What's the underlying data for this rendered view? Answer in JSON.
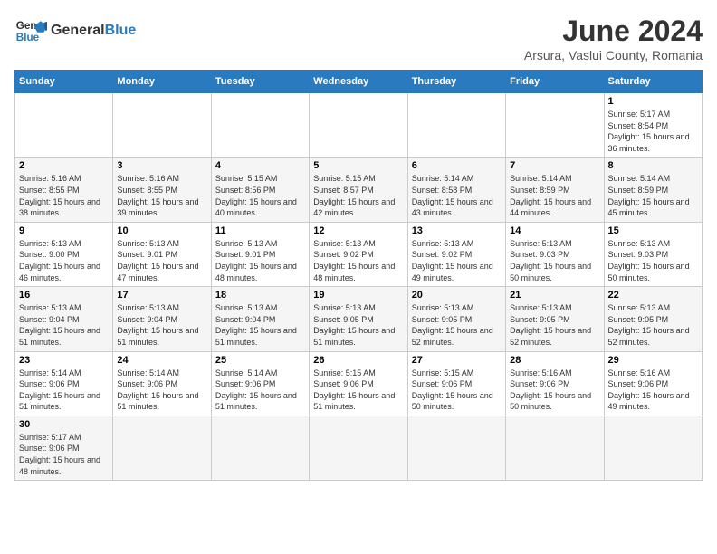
{
  "header": {
    "logo_general": "General",
    "logo_blue": "Blue",
    "month_title": "June 2024",
    "subtitle": "Arsura, Vaslui County, Romania"
  },
  "weekdays": [
    "Sunday",
    "Monday",
    "Tuesday",
    "Wednesday",
    "Thursday",
    "Friday",
    "Saturday"
  ],
  "weeks": [
    [
      {
        "day": "",
        "info": ""
      },
      {
        "day": "",
        "info": ""
      },
      {
        "day": "",
        "info": ""
      },
      {
        "day": "",
        "info": ""
      },
      {
        "day": "",
        "info": ""
      },
      {
        "day": "",
        "info": ""
      },
      {
        "day": "1",
        "info": "Sunrise: 5:17 AM\nSunset: 8:54 PM\nDaylight: 15 hours and 36 minutes."
      }
    ],
    [
      {
        "day": "2",
        "info": "Sunrise: 5:16 AM\nSunset: 8:55 PM\nDaylight: 15 hours and 38 minutes."
      },
      {
        "day": "3",
        "info": "Sunrise: 5:16 AM\nSunset: 8:55 PM\nDaylight: 15 hours and 39 minutes."
      },
      {
        "day": "4",
        "info": "Sunrise: 5:15 AM\nSunset: 8:56 PM\nDaylight: 15 hours and 40 minutes."
      },
      {
        "day": "5",
        "info": "Sunrise: 5:15 AM\nSunset: 8:57 PM\nDaylight: 15 hours and 42 minutes."
      },
      {
        "day": "6",
        "info": "Sunrise: 5:14 AM\nSunset: 8:58 PM\nDaylight: 15 hours and 43 minutes."
      },
      {
        "day": "7",
        "info": "Sunrise: 5:14 AM\nSunset: 8:59 PM\nDaylight: 15 hours and 44 minutes."
      },
      {
        "day": "8",
        "info": "Sunrise: 5:14 AM\nSunset: 8:59 PM\nDaylight: 15 hours and 45 minutes."
      }
    ],
    [
      {
        "day": "9",
        "info": "Sunrise: 5:13 AM\nSunset: 9:00 PM\nDaylight: 15 hours and 46 minutes."
      },
      {
        "day": "10",
        "info": "Sunrise: 5:13 AM\nSunset: 9:01 PM\nDaylight: 15 hours and 47 minutes."
      },
      {
        "day": "11",
        "info": "Sunrise: 5:13 AM\nSunset: 9:01 PM\nDaylight: 15 hours and 48 minutes."
      },
      {
        "day": "12",
        "info": "Sunrise: 5:13 AM\nSunset: 9:02 PM\nDaylight: 15 hours and 48 minutes."
      },
      {
        "day": "13",
        "info": "Sunrise: 5:13 AM\nSunset: 9:02 PM\nDaylight: 15 hours and 49 minutes."
      },
      {
        "day": "14",
        "info": "Sunrise: 5:13 AM\nSunset: 9:03 PM\nDaylight: 15 hours and 50 minutes."
      },
      {
        "day": "15",
        "info": "Sunrise: 5:13 AM\nSunset: 9:03 PM\nDaylight: 15 hours and 50 minutes."
      }
    ],
    [
      {
        "day": "16",
        "info": "Sunrise: 5:13 AM\nSunset: 9:04 PM\nDaylight: 15 hours and 51 minutes."
      },
      {
        "day": "17",
        "info": "Sunrise: 5:13 AM\nSunset: 9:04 PM\nDaylight: 15 hours and 51 minutes."
      },
      {
        "day": "18",
        "info": "Sunrise: 5:13 AM\nSunset: 9:04 PM\nDaylight: 15 hours and 51 minutes."
      },
      {
        "day": "19",
        "info": "Sunrise: 5:13 AM\nSunset: 9:05 PM\nDaylight: 15 hours and 51 minutes."
      },
      {
        "day": "20",
        "info": "Sunrise: 5:13 AM\nSunset: 9:05 PM\nDaylight: 15 hours and 52 minutes."
      },
      {
        "day": "21",
        "info": "Sunrise: 5:13 AM\nSunset: 9:05 PM\nDaylight: 15 hours and 52 minutes."
      },
      {
        "day": "22",
        "info": "Sunrise: 5:13 AM\nSunset: 9:05 PM\nDaylight: 15 hours and 52 minutes."
      }
    ],
    [
      {
        "day": "23",
        "info": "Sunrise: 5:14 AM\nSunset: 9:06 PM\nDaylight: 15 hours and 51 minutes."
      },
      {
        "day": "24",
        "info": "Sunrise: 5:14 AM\nSunset: 9:06 PM\nDaylight: 15 hours and 51 minutes."
      },
      {
        "day": "25",
        "info": "Sunrise: 5:14 AM\nSunset: 9:06 PM\nDaylight: 15 hours and 51 minutes."
      },
      {
        "day": "26",
        "info": "Sunrise: 5:15 AM\nSunset: 9:06 PM\nDaylight: 15 hours and 51 minutes."
      },
      {
        "day": "27",
        "info": "Sunrise: 5:15 AM\nSunset: 9:06 PM\nDaylight: 15 hours and 50 minutes."
      },
      {
        "day": "28",
        "info": "Sunrise: 5:16 AM\nSunset: 9:06 PM\nDaylight: 15 hours and 50 minutes."
      },
      {
        "day": "29",
        "info": "Sunrise: 5:16 AM\nSunset: 9:06 PM\nDaylight: 15 hours and 49 minutes."
      }
    ],
    [
      {
        "day": "30",
        "info": "Sunrise: 5:17 AM\nSunset: 9:06 PM\nDaylight: 15 hours and 48 minutes."
      },
      {
        "day": "",
        "info": ""
      },
      {
        "day": "",
        "info": ""
      },
      {
        "day": "",
        "info": ""
      },
      {
        "day": "",
        "info": ""
      },
      {
        "day": "",
        "info": ""
      },
      {
        "day": "",
        "info": ""
      }
    ]
  ]
}
